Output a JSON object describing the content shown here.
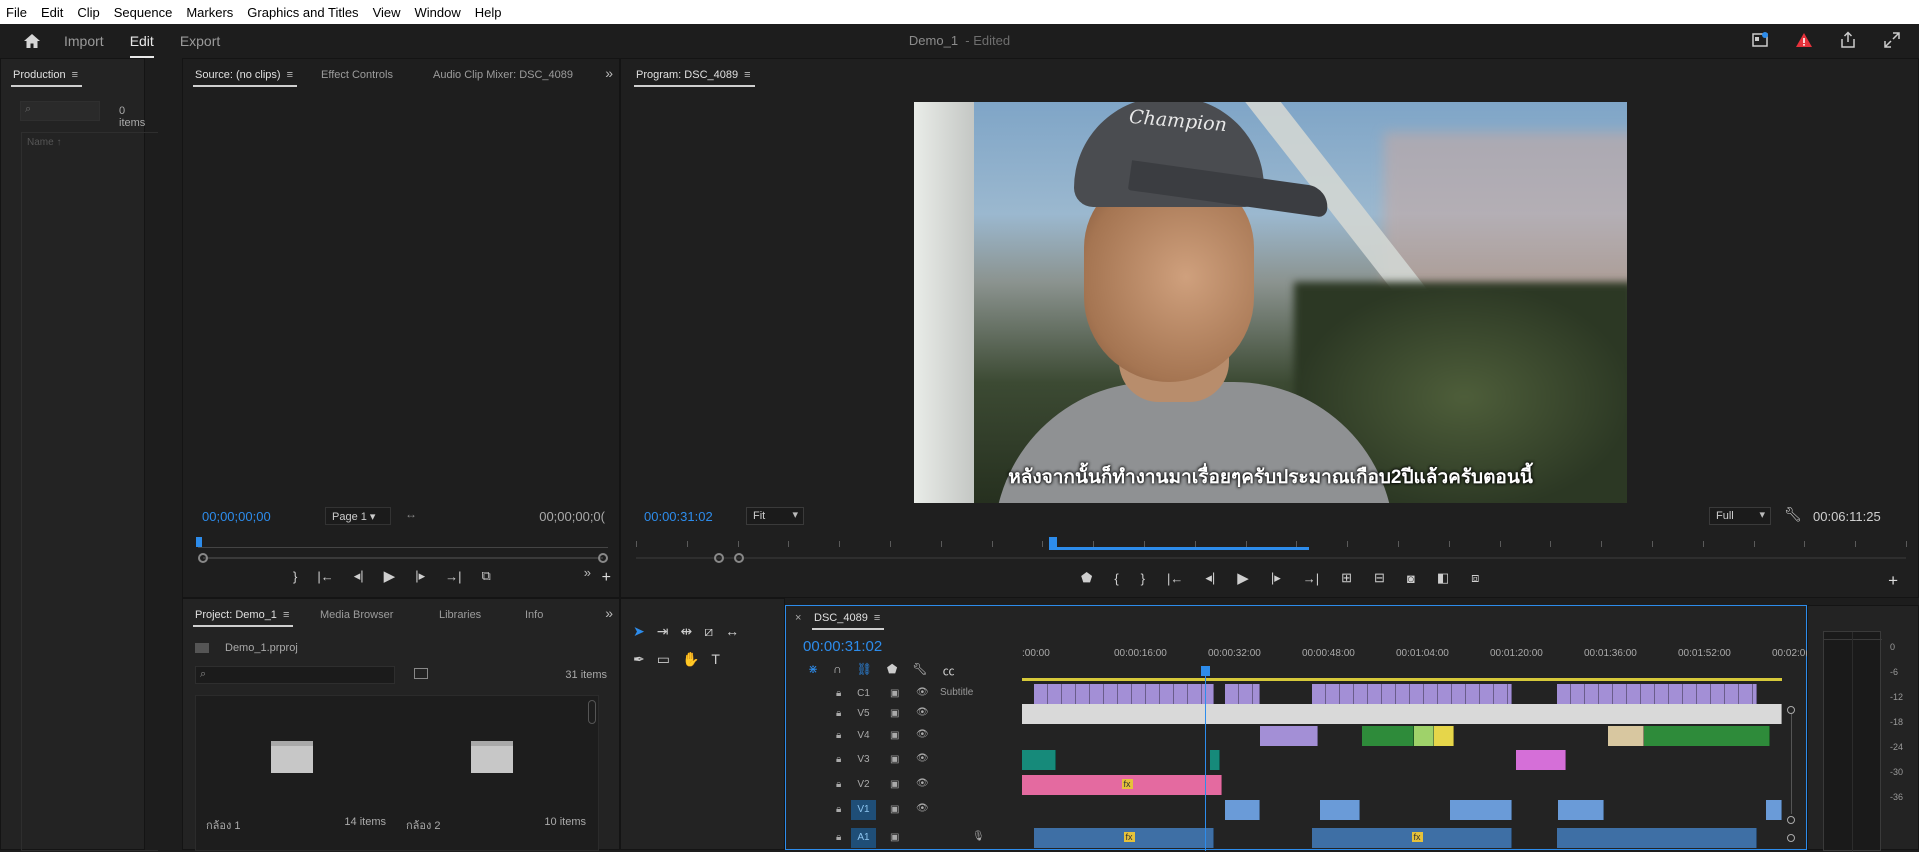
{
  "menu": [
    "File",
    "Edit",
    "Clip",
    "Sequence",
    "Markers",
    "Graphics and Titles",
    "View",
    "Window",
    "Help"
  ],
  "header": {
    "tabs": [
      {
        "label": "Import"
      },
      {
        "label": "Edit",
        "active": true
      },
      {
        "label": "Export"
      }
    ],
    "doc_title": "Demo_1",
    "doc_status": "- Edited"
  },
  "production": {
    "title": "Production",
    "count": "0 items",
    "col_name": "Name ↑"
  },
  "source": {
    "tabs": [
      "Source: (no clips)",
      "Effect Controls",
      "Audio Clip Mixer: DSC_4089"
    ],
    "timecode_in": "00;00;00;00",
    "page": "Page 1",
    "timecode_out": "00;00;00;0("
  },
  "program": {
    "title": "Program: DSC_4089",
    "subtitle": "หลังจากนั้นก็ทำงานมาเรื่อยๆครับประมาณเกือบ2ปีแล้วครับตอนนี้",
    "cap_text": "Champion",
    "timecode": "00:00:31:02",
    "fit": "Fit",
    "quality": "Full",
    "duration": "00:06:11:25",
    "playhead_fraction": 0.33
  },
  "project": {
    "tabs": [
      "Project: Demo_1",
      "Media Browser",
      "Libraries",
      "Info"
    ],
    "file": "Demo_1.prproj",
    "count": "31 items",
    "bins": [
      {
        "name": "กล้อง 1",
        "count": "14 items"
      },
      {
        "name": "กล้อง 2",
        "count": "10 items"
      }
    ]
  },
  "timeline": {
    "sequence": "DSC_4089",
    "timecode": "00:00:31:02",
    "ruler": [
      ":00:00",
      "00:00:16:00",
      "00:00:32:00",
      "00:00:48:00",
      "00:01:04:00",
      "00:01:20:00",
      "00:01:36:00",
      "00:01:52:00",
      "00:02:0("
    ],
    "tracks": [
      {
        "id": "C1",
        "label": "Subtitle"
      },
      {
        "id": "V5",
        "label": ""
      },
      {
        "id": "V4",
        "label": ""
      },
      {
        "id": "V3",
        "label": ""
      },
      {
        "id": "V2",
        "label": ""
      },
      {
        "id": "V1",
        "label": ""
      },
      {
        "id": "A1",
        "label": ""
      }
    ],
    "audio_buttons": [
      "M",
      "S"
    ],
    "fx_label": "fx"
  },
  "meter": {
    "labels": [
      "0",
      "-6",
      "-12",
      "-18",
      "-24",
      "-30",
      "-36"
    ]
  },
  "colors": {
    "accent": "#2d8ceb",
    "subtitle_clip": "#a38fd6",
    "v4_green": "#2e8b3a",
    "v3_teal": "#168a7a",
    "v2_pink": "#e46aa0",
    "v1_blue": "#6a9bd8",
    "a1_blue": "#3e6fa5",
    "v3_magenta": "#d56fd8",
    "yellow": "#e6d64a"
  }
}
